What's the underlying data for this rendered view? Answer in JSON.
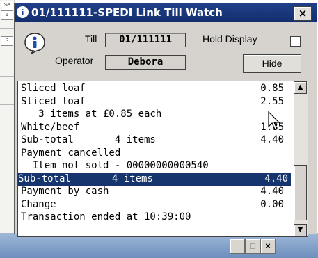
{
  "background": {
    "left_labels": [
      "Se",
      "1",
      "R"
    ]
  },
  "dialog": {
    "title": "01/111111-SPEDI Link Till Watch",
    "close_label": "×",
    "till_label": "Till",
    "till_value": "01/111111",
    "operator_label": "Operator",
    "operator_value": "Debora",
    "hold_display_label": "Hold Display",
    "hold_display_checked": false,
    "hide_label": "Hide"
  },
  "journal": {
    "rows": [
      {
        "text": "Sliced loaf",
        "value": "0.85"
      },
      {
        "text": "Sliced loaf",
        "value": "2.55"
      },
      {
        "text": "   3 items at £0.85 each",
        "value": ""
      },
      {
        "text": "White/beef",
        "value": "1.85"
      },
      {
        "text": "Sub-total       4 items",
        "value": "4.40"
      },
      {
        "text": "Payment cancelled",
        "value": ""
      },
      {
        "text": "  Item not sold - 00000000000540",
        "value": ""
      },
      {
        "text": "Sub-total       4 items",
        "value": "4.40"
      },
      {
        "text": "Payment by cash",
        "value": "4.40"
      },
      {
        "text": "Change",
        "value": "0.00"
      },
      {
        "text": "Transaction ended at 10:39:00",
        "value": ""
      }
    ],
    "selected_index": 7
  },
  "scrollbar": {
    "up_icon": "up-arrow-icon",
    "down_icon": "down-arrow-icon"
  },
  "taskbar": {
    "minimize_label": "_",
    "maximize_label": "□",
    "close_label": "×"
  },
  "colors": {
    "titlebar": "#1a3a80",
    "selection": "#16356e",
    "dialog_face": "#d6d3ce"
  }
}
